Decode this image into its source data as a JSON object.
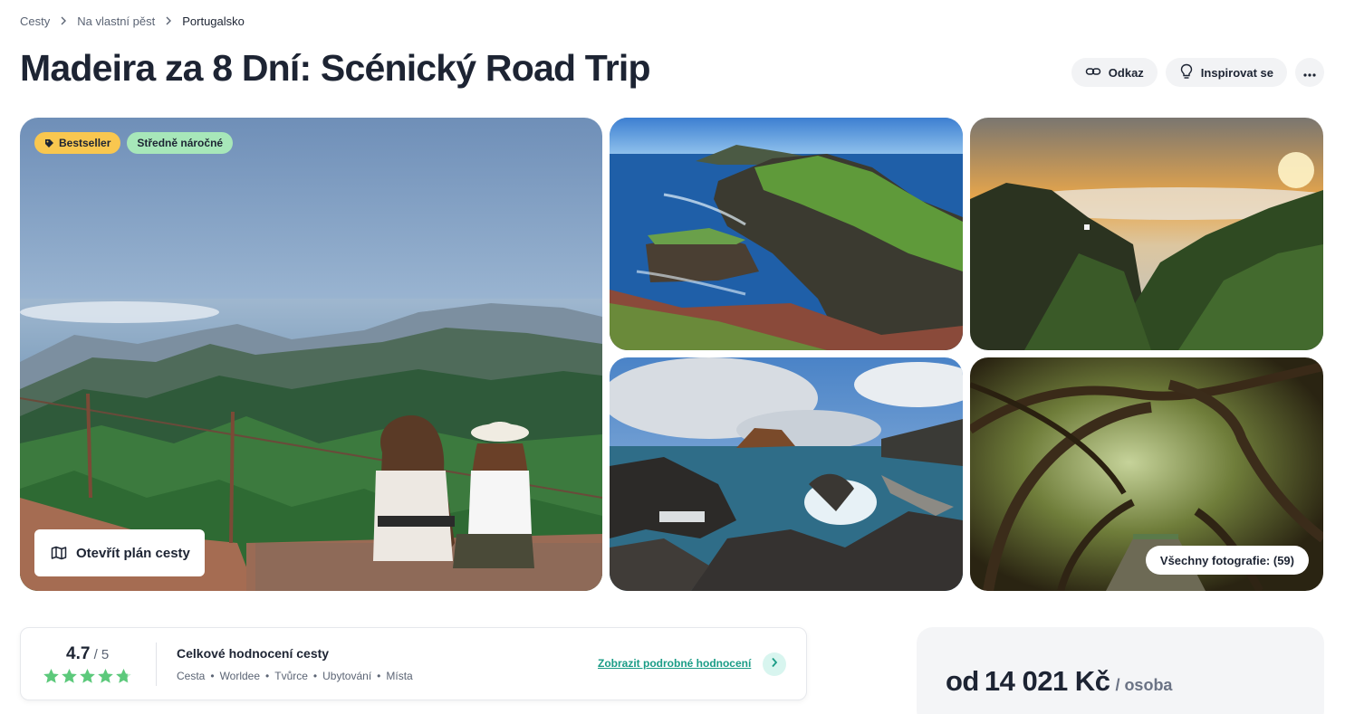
{
  "breadcrumb": {
    "items": [
      "Cesty",
      "Na vlastní pěst",
      "Portugalsko"
    ]
  },
  "page": {
    "title": "Madeira za 8 Dní: Scénický Road Trip"
  },
  "actions": {
    "link_label": "Odkaz",
    "inspire_label": "Inspirovat se"
  },
  "gallery": {
    "badges": {
      "bestseller": "Bestseller",
      "difficulty": "Středně náročné"
    },
    "open_plan_label": "Otevřít plán cesty",
    "all_photos_label": "Všechny fotografie: (59)"
  },
  "rating": {
    "score": "4.7",
    "out_of": " / 5",
    "stars": 4.7,
    "title": "Celkové hodnocení cesty",
    "categories": [
      "Cesta",
      "Worldee",
      "Tvůrce",
      "Ubytování",
      "Místa"
    ],
    "detail_link": "Zobrazit podrobné hodnocení"
  },
  "price": {
    "from": "od",
    "amount": "14 021 Kč",
    "per": "/ osoba"
  },
  "colors": {
    "accent": "#1a9c86",
    "star": "#5cc97b",
    "bestseller_badge": "#f9c74f",
    "difficulty_badge": "#a7e7b9",
    "text": "#1d2433"
  }
}
